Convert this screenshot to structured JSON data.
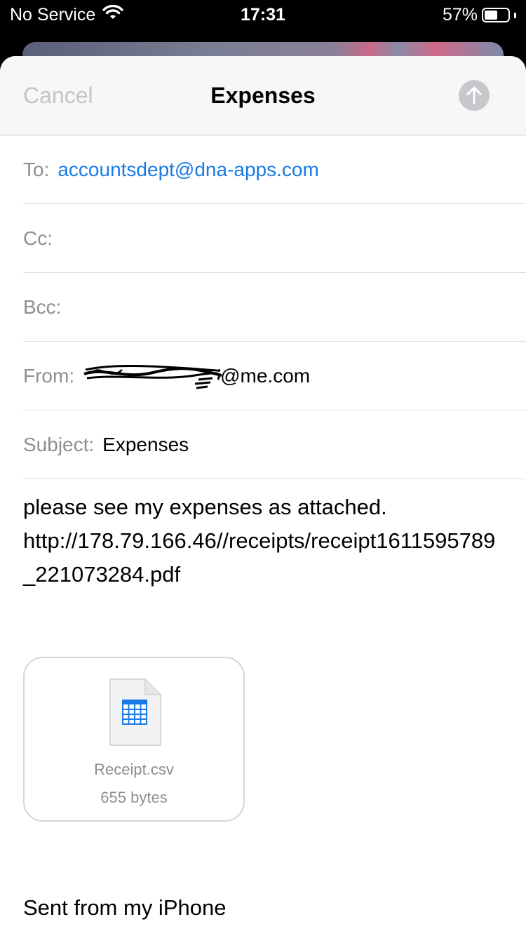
{
  "status_bar": {
    "carrier": "No Service",
    "time": "17:31",
    "battery": "57%",
    "battery_level": 0.57
  },
  "nav": {
    "cancel": "Cancel",
    "title": "Expenses"
  },
  "fields": {
    "to_label": "To:",
    "to_value": "accountsdept@dna-apps.com",
    "cc_label": "Cc:",
    "bcc_label": "Bcc:",
    "from_label": "From:",
    "from_value_domain": "@me.com",
    "subject_label": "Subject:",
    "subject_value": "Expenses"
  },
  "body": {
    "line1": "please see my expenses as attached.",
    "line2": "http://178.79.166.46//receipts/receipt1611595789_221073284.pdf"
  },
  "attachment": {
    "name": "Receipt.csv",
    "size": "655 bytes"
  },
  "signature": "Sent from my iPhone"
}
